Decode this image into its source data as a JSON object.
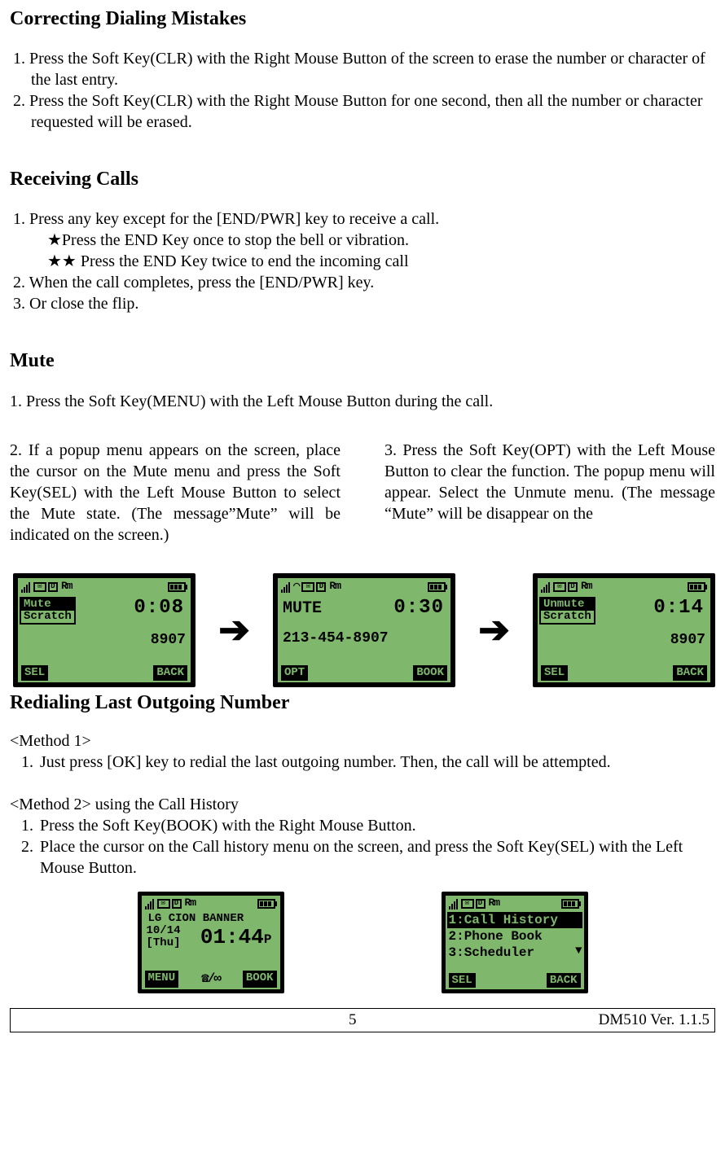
{
  "s1": {
    "title": "Correcting Dialing Mistakes",
    "i1": "1. Press the Soft Key(CLR) with the Right Mouse Button of the screen to erase the number or character of the last entry.",
    "i2": "2. Press the Soft Key(CLR) with the Right Mouse Button for one second, then all the number or character requested will be erased."
  },
  "s2": {
    "title": "Receiving Calls",
    "i1": "1. Press any key except for the [END/PWR] key to receive a call.",
    "star1": "★Press the END Key once to stop the bell or vibration.",
    "star2": "★★ Press the END Key twice to end the incoming call",
    "i2": "2. When the call completes, press the [END/PWR] key.",
    "i3": "3. Or close the flip."
  },
  "s3": {
    "title": "Mute",
    "i1": "1. Press the Soft Key(MENU) with the Left Mouse Button during the call.",
    "col1": "2. If a popup menu appears on the screen, place the cursor on the Mute menu and press the Soft Key(SEL) with the Left Mouse Button to select the Mute state. (The message”Mute” will be indicated on the screen.)",
    "col2": "3. Press the Soft Key(OPT) with the Left Mouse Button to clear the function. The popup menu will appear. Select the Unmute menu. (The message “Mute” will be disappear on the"
  },
  "screens": {
    "scr1": {
      "popup_item1": "Mute",
      "popup_item2": "Scratch",
      "time": "0:08",
      "number_tail": "8907",
      "sk_left": "SEL",
      "sk_right": "BACK"
    },
    "scr2": {
      "mute_label": "MUTE",
      "time": "0:30",
      "phone": "213-454-8907",
      "sk_left": "OPT",
      "sk_right": "BOOK"
    },
    "scr3": {
      "popup_item1": "Unmute",
      "popup_item2": "Scratch",
      "time": "0:14",
      "number_tail": "8907",
      "sk_left": "SEL",
      "sk_right": "BACK"
    },
    "status_d": "D",
    "status_rm": "Rm"
  },
  "s4": {
    "title": "Redialing Last Outgoing Number",
    "m1_label": "<Method 1>",
    "m1_i1n": "1.",
    "m1_i1t": "Just press [OK] key to redial the last outgoing number. Then, the call will be attempted.",
    "m2_label": "<Method 2> using the Call History",
    "m2_i1n": "1.",
    "m2_i1t": "Press the Soft Key(BOOK) with the Right Mouse Button.",
    "m2_i2n": "2.",
    "m2_i2t": "Place the cursor on the Call history menu on the screen, and press the Soft Key(SEL) with the Left Mouse Button."
  },
  "bscreens": {
    "home": {
      "banner": "LG CION BANNER",
      "date": "10/14",
      "day": "[Thu]",
      "clock": "01:44",
      "ampm": "P",
      "sk_left": "MENU",
      "sk_right": "BOOK",
      "vm": "☎/∞"
    },
    "menu": {
      "l1": "1:Call History",
      "l2": "2:Phone Book",
      "l3": "3:Scheduler",
      "sk_left": "SEL",
      "sk_right": "BACK"
    }
  },
  "footer": {
    "page": "5",
    "ver": "DM510    Ver. 1.1.5"
  }
}
